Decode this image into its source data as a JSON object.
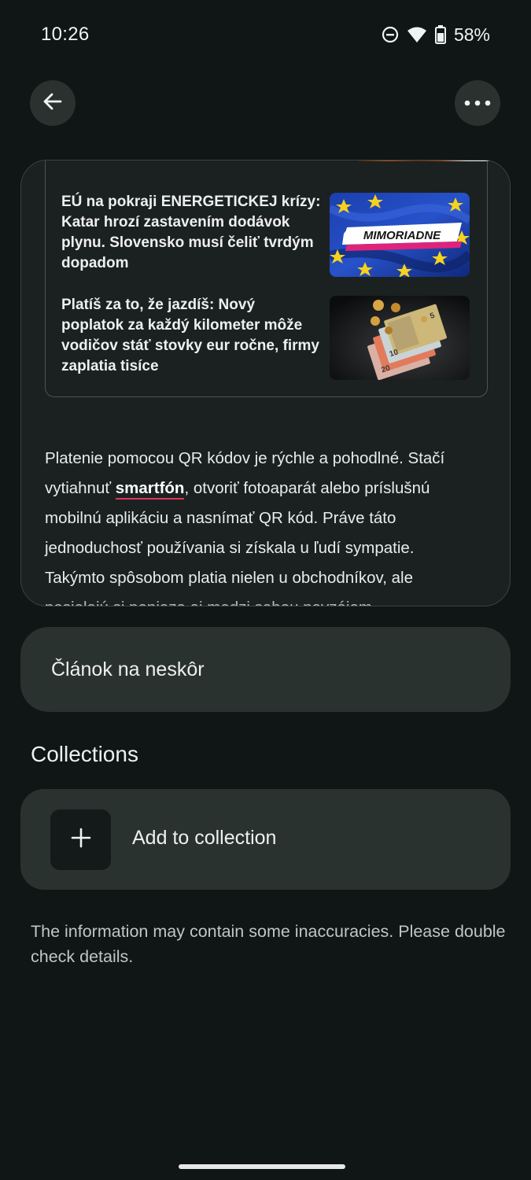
{
  "status_bar": {
    "time": "10:26",
    "battery_percent": "58%",
    "icons": [
      "do-not-disturb-icon",
      "wifi-icon",
      "battery-icon"
    ]
  },
  "toolbar": {
    "back_icon": "arrow-back-icon",
    "more_icon": "more-horizontal-icon"
  },
  "preview": {
    "related_news": [
      {
        "title": "EÚ na pokraji ENERGETICKEJ krízy: Katar hrozí zastavením dodávok plynu. Slovensko musí čeliť tvrdým dopadom",
        "thumb_label": "MIMORIADNE"
      },
      {
        "title": "Platíš za to, že jazdíš: Nový poplatok za každý kilometer môže vodičov stáť stovky eur ročne, firmy zaplatia tisíce"
      }
    ],
    "article": {
      "line1": "Platenie pomocou QR kódov je rýchle a pohodlné. Stačí",
      "line2_pre": "vytiahnuť ",
      "link_word": "smartfón",
      "line2_post": ", otvoriť fotoaparát alebo príslušnú",
      "line3": "mobilnú aplikáciu a nasnímať QR kód. Práve táto",
      "line4": "jednoduchosť používania si získala u ľudí sympatie.",
      "line5": "Takýmto spôsobom platia nielen u obchodníkov, ale",
      "line6": "posielajú si peniaze aj medzi sebou navzájom."
    }
  },
  "later": {
    "label": "Článok na neskôr"
  },
  "collections": {
    "heading": "Collections",
    "add_label": "Add to collection"
  },
  "disclaimer": "The information may contain some inaccuracies. Please double check details.",
  "colors": {
    "background": "#0f1615",
    "surface": "#2a322f",
    "link_underline": "#e2345a"
  }
}
